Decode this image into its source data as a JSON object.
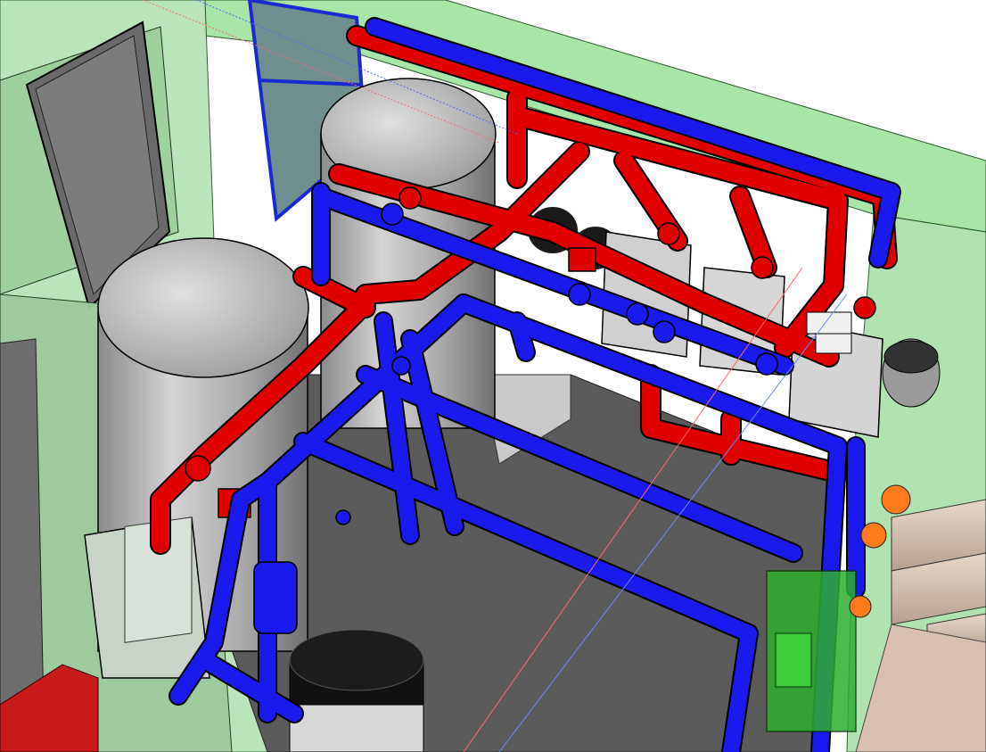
{
  "scene": {
    "kind": "3d-cad-model",
    "subject": "boiler-room-piping",
    "colors": {
      "hot_pipe": "#e00000",
      "cold_pipe": "#1a1aee",
      "tank": "#bdbdbd",
      "glass_wall": "#9fdf9f",
      "floor": "#5a5a5a",
      "background": "#ffffff",
      "flue": "#d8c6b6",
      "edge": "#000000"
    }
  }
}
